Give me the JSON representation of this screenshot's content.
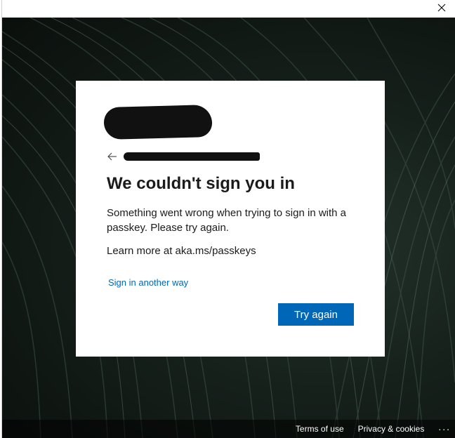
{
  "window": {
    "close_icon": "close-icon"
  },
  "dialog": {
    "back_icon": "back-arrow-icon",
    "title": "We couldn't sign you in",
    "message": "Something went wrong when trying to sign in with a passkey. Please try again.",
    "learn_more": "Learn more at aka.ms/passkeys",
    "other_way_link": "Sign in another way",
    "try_again_label": "Try again"
  },
  "footer": {
    "terms": "Terms of use",
    "privacy": "Privacy & cookies",
    "more": "..."
  },
  "colors": {
    "accent": "#0067b8",
    "link": "#0067b8",
    "text": "#1b1b1b",
    "backdrop": "#16201b"
  }
}
